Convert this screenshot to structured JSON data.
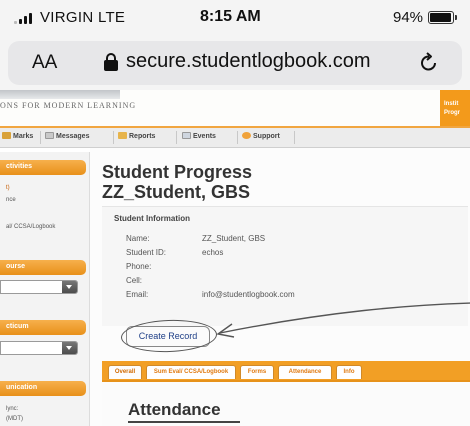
{
  "status_bar": {
    "carrier": "VIRGIN LTE",
    "time": "8:15 AM",
    "battery_percent": "94%",
    "battery_level": 0.94,
    "signal_icon": "signal-bars-icon",
    "battery_icon": "battery-icon"
  },
  "address_bar": {
    "text_size_label": "AA",
    "url": "secure.studentlogbook.com",
    "lock_icon": "lock-icon",
    "reload_icon": "reload-icon"
  },
  "site": {
    "tagline": "ONS FOR MODERN LEARNING",
    "corner_lines": [
      "Instit",
      "Progr"
    ],
    "accent_color": "#f29f25"
  },
  "nav": {
    "items": [
      "Marks",
      "Messages",
      "Reports",
      "Events",
      "Support"
    ]
  },
  "sidebar": {
    "activities_header": "ctivities",
    "activities_link": "t)",
    "activities_text": "nce",
    "activities_eval": "al/ CCSA/Logbook",
    "course_header": "ourse",
    "practicum_header": "cticum",
    "communication_header": "unication",
    "sync_label": "lync:",
    "sync_time": "(MDT)"
  },
  "main": {
    "title_line1": "Student Progress",
    "title_line2": "ZZ_Student, GBS",
    "info_heading": "Student Information",
    "fields": [
      {
        "label": "Name:",
        "value": "ZZ_Student, GBS"
      },
      {
        "label": "Student ID:",
        "value": "echos"
      },
      {
        "label": "Phone:",
        "value": ""
      },
      {
        "label": "Cell:",
        "value": ""
      },
      {
        "label": "Email:",
        "value": "info@studentlogbook.com"
      }
    ],
    "create_record_label": "Create Record",
    "tabs": [
      "Overall",
      "Sum Eval/ CCSA/Logbook",
      "Forms",
      "Attendance",
      "Info"
    ],
    "active_tab": "Overall",
    "section_heading": "Attendance"
  }
}
